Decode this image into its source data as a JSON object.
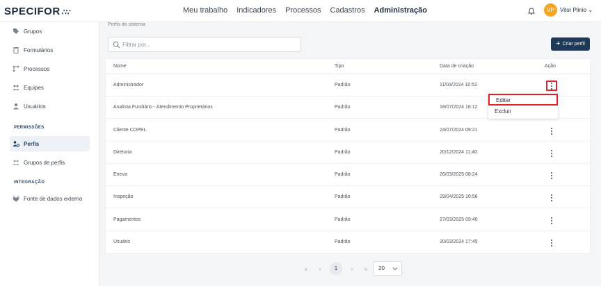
{
  "app": {
    "logo": "SPECIFOR",
    "logo_mark": "∴∵"
  },
  "nav": [
    "Meu trabalho",
    "Indicadores",
    "Processos",
    "Cadastros",
    "Administração"
  ],
  "nav_active": 4,
  "user": {
    "initials": "VP",
    "name": "Vitor Plinio"
  },
  "sidebar": {
    "items_top": [
      {
        "label": "Grupos",
        "icon": "tag-icon"
      },
      {
        "label": "Formulários",
        "icon": "clipboard-icon"
      },
      {
        "label": "Processos",
        "icon": "flow-icon"
      },
      {
        "label": "Equipes",
        "icon": "team-icon"
      },
      {
        "label": "Usuários",
        "icon": "user-icon"
      }
    ],
    "section_permissoes": "PERMISSÕES",
    "items_perm": [
      {
        "label": "Perfis",
        "icon": "profile-gear-icon",
        "active": true
      },
      {
        "label": "Grupos de perfis",
        "icon": "profiles-group-icon"
      }
    ],
    "section_integracao": "INTEGRAÇÃO",
    "items_int": [
      {
        "label": "Fonte de dados externo",
        "icon": "plug-icon"
      }
    ]
  },
  "main": {
    "title": "Perfis do sistema",
    "search_placeholder": "Filtrar por...",
    "create_label": "Criar perfil",
    "columns": {
      "nome": "Nome",
      "tipo": "Tipo",
      "data": "Data de criação",
      "acao": "Ação"
    },
    "rows": [
      {
        "nome": "Administrador",
        "tipo": "Padrão",
        "data": "11/03/2024 10:52"
      },
      {
        "nome": "Analista Fundiário - Atendimento Proprietários",
        "tipo": "Padrão",
        "data": "18/07/2024 16:12"
      },
      {
        "nome": "Cliente COPEL",
        "tipo": "Padrão",
        "data": "24/07/2024 09:21"
      },
      {
        "nome": "Diretoria",
        "tipo": "Padrão",
        "data": "20/12/2024 11:40"
      },
      {
        "nome": "Eneva",
        "tipo": "Padrão",
        "data": "26/03/2025 08:24"
      },
      {
        "nome": "Inspeção",
        "tipo": "Padrão",
        "data": "29/04/2025 10:56"
      },
      {
        "nome": "Pagamentos",
        "tipo": "Padrão",
        "data": "27/03/2025 09:40"
      },
      {
        "nome": "Usuário",
        "tipo": "Padrão",
        "data": "20/03/2024 17:45"
      }
    ],
    "row_menu": {
      "edit": "Editar",
      "delete": "Excluir"
    }
  },
  "pagination": {
    "first": "«",
    "prev": "‹",
    "current": "1",
    "next": "›",
    "last": "»",
    "page_size": "20"
  },
  "colors": {
    "primary": "#1e3a57",
    "highlight": "#e0202a",
    "avatar": "#f4a623"
  }
}
